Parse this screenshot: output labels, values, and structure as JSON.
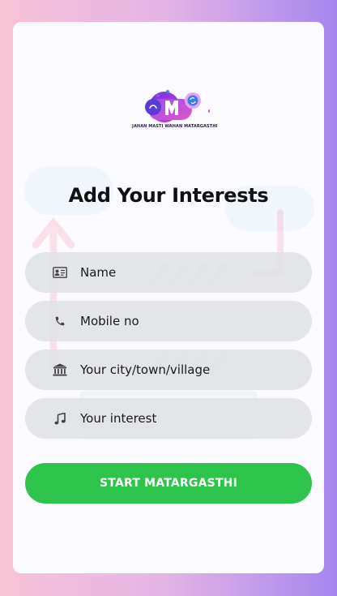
{
  "brand": {
    "logo_text": "MATARGASTHI",
    "tagline": "JAHAN MASTI WAHAN MATARGASTHI"
  },
  "form": {
    "title": "Add Your Interests",
    "fields": [
      {
        "placeholder": "Name",
        "icon": "contact-card-icon"
      },
      {
        "placeholder": "Mobile no",
        "icon": "phone-icon"
      },
      {
        "placeholder": "Your city/town/village",
        "icon": "bank-building-icon"
      },
      {
        "placeholder": "Your interest",
        "icon": "music-note-icon"
      }
    ],
    "submit_label": "START MATARGASTHI"
  },
  "colors": {
    "background_start": "#f9c3d6",
    "background_end": "#a487ee",
    "card": "#fbfafe",
    "field": "#dfe1e6",
    "button": "#2ec44c",
    "button_text": "#ffffff"
  }
}
